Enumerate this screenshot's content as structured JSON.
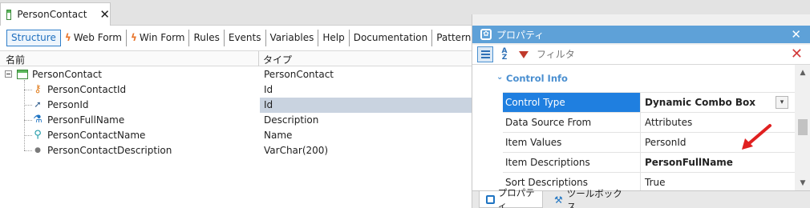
{
  "document_tab": {
    "label": "PersonContact",
    "close": "✕"
  },
  "subtabs": [
    {
      "label": "Structure",
      "icon": ""
    },
    {
      "label": "Web Form",
      "icon": "web-form-icon"
    },
    {
      "label": "Win Form",
      "icon": "win-form-icon"
    },
    {
      "label": "Rules"
    },
    {
      "label": "Events"
    },
    {
      "label": "Variables"
    },
    {
      "label": "Help"
    },
    {
      "label": "Documentation"
    },
    {
      "label": "Patterns"
    }
  ],
  "columns": {
    "name": "名前",
    "type": "タイプ"
  },
  "tree": {
    "root": {
      "name": "PersonContact",
      "type": "PersonContact"
    },
    "children": [
      {
        "name": "PersonContactId",
        "type": "Id",
        "icon": "key-icon"
      },
      {
        "name": "PersonId",
        "type": "Id",
        "icon": "foreign-key-arrow-icon"
      },
      {
        "name": "PersonFullName",
        "type": "Description",
        "icon": "formula-flask-icon"
      },
      {
        "name": "PersonContactName",
        "type": "Name",
        "icon": "description-pin-icon"
      },
      {
        "name": "PersonContactDescription",
        "type": "VarChar(200)",
        "icon": "attribute-dot-icon"
      }
    ]
  },
  "properties": {
    "title": "プロパティ",
    "close": "✕",
    "filter_placeholder": "フィルタ",
    "category": "Control Info",
    "rows": [
      {
        "name": "Control Type",
        "value": "Dynamic Combo Box"
      },
      {
        "name": "Data Source From",
        "value": "Attributes"
      },
      {
        "name": "Item Values",
        "value": "PersonId"
      },
      {
        "name": "Item Descriptions",
        "value": "PersonFullName"
      },
      {
        "name": "Sort Descriptions",
        "value": "True"
      }
    ],
    "bottom_tabs": [
      {
        "label": "プロパティ"
      },
      {
        "label": "ツールボックス"
      }
    ]
  },
  "colors": {
    "panel_title_bg": "#5ea1d8",
    "selected_property_bg": "#1f7fe0",
    "selected_type_bg": "#c9d3e0",
    "annotation_arrow": "#e02020",
    "category_text": "#4a8fd0"
  }
}
